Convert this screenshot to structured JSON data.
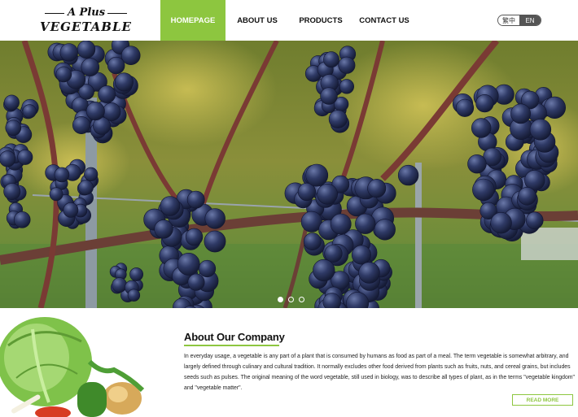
{
  "logo": {
    "top": "A Plus",
    "main": "VEGETABLE"
  },
  "nav": {
    "items": [
      {
        "label": "HOMEPAGE",
        "active": true
      },
      {
        "label": "ABOUT US",
        "active": false
      },
      {
        "label": "PRODUCTS",
        "active": false
      },
      {
        "label": "CONTACT US",
        "active": false
      }
    ]
  },
  "language": {
    "zh": "繁中",
    "en": "EN",
    "selected": "EN"
  },
  "slider": {
    "slides": 3,
    "active_index": 1
  },
  "about": {
    "title": "About Our Company",
    "text": "In everyday usage, a vegetable is any part of a plant that is consumed by humans as food as part of a meal. The term vegetable is somewhat arbitrary, and largely defined through culinary and cultural tradition. It normally excludes other food derived from plants such as fruits, nuts, and cereal grains, but includes seeds such as pulses. The original meaning of the word vegetable, still used in biology, was to describe all types of plant, as in the terms \"vegetable kingdom\" and \"vegetable matter\".",
    "read_more": "READ MORE"
  },
  "colors": {
    "accent": "#8dc63f",
    "grape": "#2c3560"
  }
}
